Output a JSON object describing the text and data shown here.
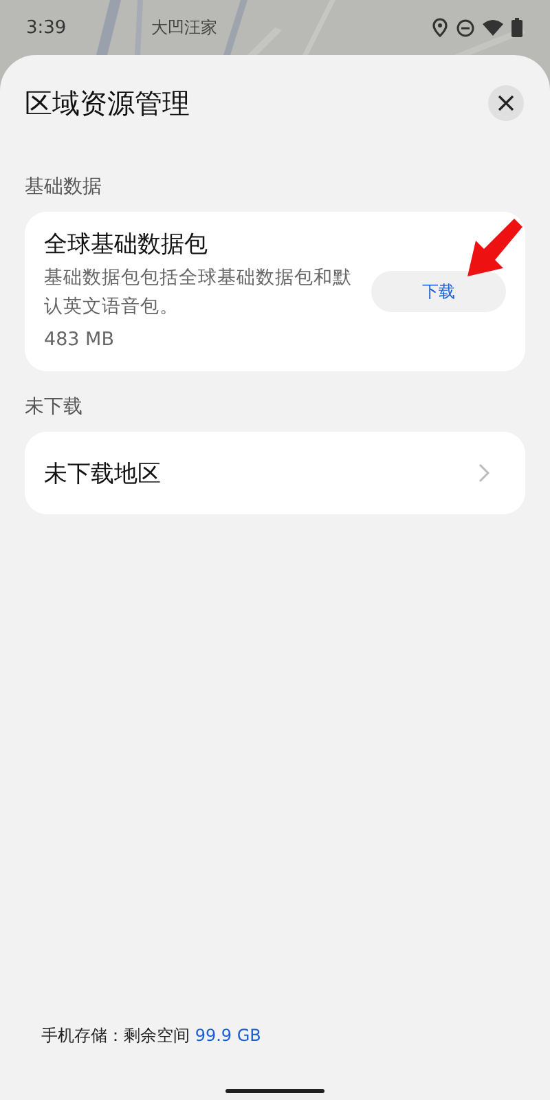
{
  "status_bar": {
    "time": "3:39",
    "place": "大凹汪家"
  },
  "sheet": {
    "title": "区域资源管理"
  },
  "sections": [
    {
      "kind": "package",
      "header": "基础数据",
      "title": "全球基础数据包",
      "description": "基础数据包包括全球基础数据包和默认英文语音包。",
      "size": "483 MB",
      "button": "下载"
    },
    {
      "kind": "link",
      "header": "未下载",
      "title": "未下载地区"
    }
  ],
  "storage": {
    "label": "手机存储：剩余空间 ",
    "free": "99.9 GB"
  }
}
